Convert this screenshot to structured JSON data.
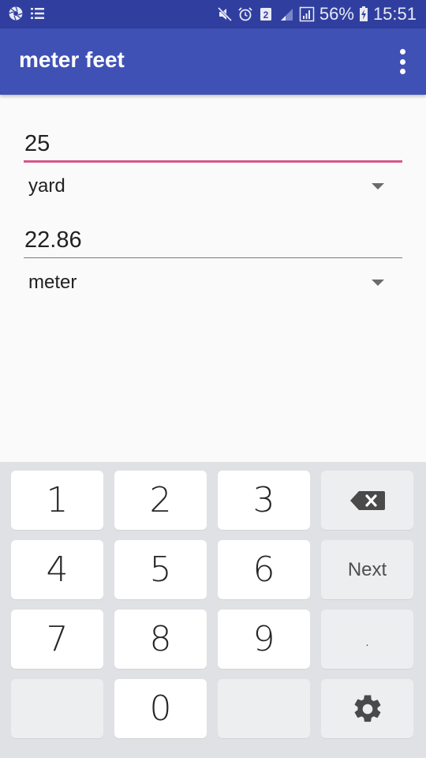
{
  "status_bar": {
    "left_icons": [
      "aperture-icon",
      "list-icon"
    ],
    "right_icons": [
      "mute-icon",
      "alarm-icon",
      "sim-2-icon",
      "signal-weak-icon",
      "signal-icon"
    ],
    "battery_percent": "56%",
    "battery_icon": "battery-charging-icon",
    "time": "15:51"
  },
  "app_bar": {
    "title": "meter feet",
    "overflow_icon": "more-vert-icon"
  },
  "colors": {
    "status_bar": "#303f9f",
    "app_bar": "#3f51b5",
    "accent": "#d6578a",
    "keyboard_bg": "#dfe1e4"
  },
  "converter": {
    "input": {
      "value": "25",
      "focused": true
    },
    "input_unit": {
      "selected": "yard"
    },
    "output": {
      "value": "22.86",
      "focused": false
    },
    "output_unit": {
      "selected": "meter"
    }
  },
  "keyboard": {
    "rows": [
      [
        {
          "label": "1"
        },
        {
          "label": "2"
        },
        {
          "label": "3"
        },
        {
          "label": "",
          "icon": "backspace-icon"
        }
      ],
      [
        {
          "label": "4"
        },
        {
          "label": "5"
        },
        {
          "label": "6"
        },
        {
          "label": "Next"
        }
      ],
      [
        {
          "label": "7"
        },
        {
          "label": "8"
        },
        {
          "label": "9"
        },
        {
          "label": "."
        }
      ],
      [
        {
          "label": ""
        },
        {
          "label": "0"
        },
        {
          "label": ""
        },
        {
          "label": "",
          "icon": "settings-icon"
        }
      ]
    ]
  }
}
